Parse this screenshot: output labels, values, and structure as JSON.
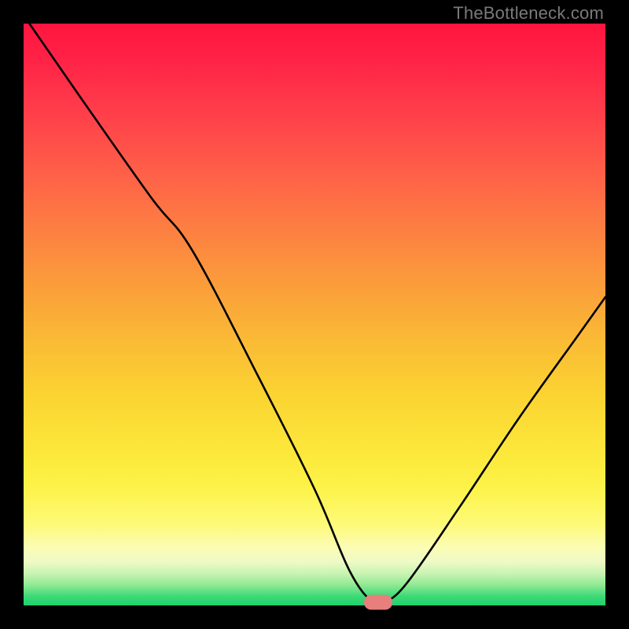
{
  "watermark": "TheBottleneck.com",
  "chart_data": {
    "type": "line",
    "title": "",
    "xlabel": "",
    "ylabel": "",
    "xlim": [
      0,
      100
    ],
    "ylim": [
      0,
      100
    ],
    "grid": false,
    "legend": false,
    "series": [
      {
        "name": "bottleneck-curve",
        "x": [
          1,
          10,
          22,
          29,
          40,
          50,
          56,
          60,
          62,
          66,
          75,
          85,
          95,
          100
        ],
        "y": [
          100,
          87,
          70,
          61,
          40,
          20,
          6,
          0.5,
          0.5,
          4,
          17,
          32,
          46,
          53
        ]
      }
    ],
    "marker": {
      "x": 61,
      "y": 0.5,
      "color": "#e77f7d"
    },
    "background_gradient_stops": [
      {
        "offset": 0.0,
        "color": "#ff153e"
      },
      {
        "offset": 0.06,
        "color": "#ff2246"
      },
      {
        "offset": 0.14,
        "color": "#ff3a4a"
      },
      {
        "offset": 0.24,
        "color": "#ff5a49"
      },
      {
        "offset": 0.34,
        "color": "#fd7b43"
      },
      {
        "offset": 0.44,
        "color": "#fb9a3b"
      },
      {
        "offset": 0.54,
        "color": "#fab935"
      },
      {
        "offset": 0.64,
        "color": "#fbd432"
      },
      {
        "offset": 0.74,
        "color": "#fce83a"
      },
      {
        "offset": 0.8,
        "color": "#fdf34a"
      },
      {
        "offset": 0.86,
        "color": "#fdfa78"
      },
      {
        "offset": 0.9,
        "color": "#fcfcb4"
      },
      {
        "offset": 0.925,
        "color": "#eefac6"
      },
      {
        "offset": 0.945,
        "color": "#c9f4b2"
      },
      {
        "offset": 0.965,
        "color": "#8fe994"
      },
      {
        "offset": 0.985,
        "color": "#3bd976"
      },
      {
        "offset": 1.0,
        "color": "#1dd26c"
      }
    ]
  }
}
